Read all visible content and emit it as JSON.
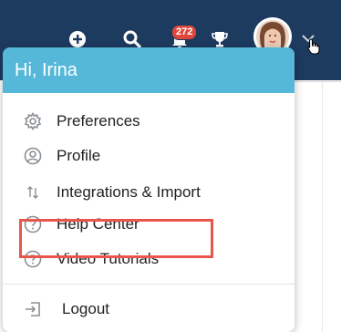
{
  "topbar": {
    "notifications_count": "272",
    "background_color": "#1d3a5f",
    "icons": [
      "plus-icon",
      "search-icon",
      "bell-icon",
      "trophy-icon",
      "chevron-down-icon"
    ]
  },
  "menu": {
    "greeting": "Hi, Irina",
    "header_color": "#56b8d8",
    "items": [
      {
        "label": "Preferences",
        "icon": "gear-icon"
      },
      {
        "label": "Profile",
        "icon": "user-circle-icon"
      },
      {
        "label": "Integrations & Import",
        "icon": "transfer-arrows-icon",
        "highlighted": true
      },
      {
        "label": "Help Center",
        "icon": "question-circle-icon"
      },
      {
        "label": "Video Tutorials",
        "icon": "question-circle-icon"
      },
      {
        "label": "Logout",
        "icon": "logout-icon"
      }
    ],
    "highlight_color": "#e8574c"
  }
}
